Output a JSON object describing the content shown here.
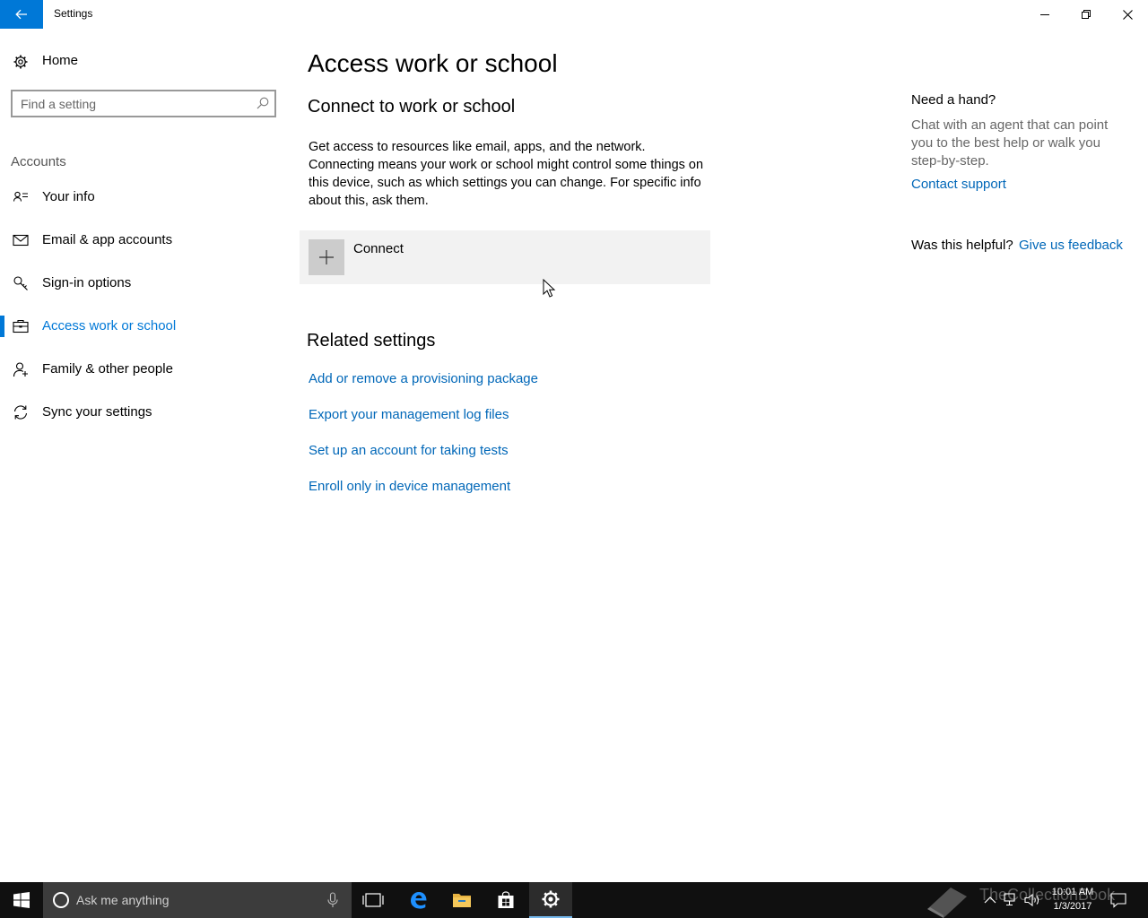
{
  "window": {
    "title": "Settings"
  },
  "sidebar": {
    "home_label": "Home",
    "search_placeholder": "Find a setting",
    "section_label": "Accounts",
    "items": [
      {
        "label": "Your info",
        "icon": "contact-card-icon",
        "active": false
      },
      {
        "label": "Email & app accounts",
        "icon": "mail-icon",
        "active": false
      },
      {
        "label": "Sign-in options",
        "icon": "key-icon",
        "active": false
      },
      {
        "label": "Access work or school",
        "icon": "briefcase-icon",
        "active": true
      },
      {
        "label": "Family & other people",
        "icon": "person-add-icon",
        "active": false
      },
      {
        "label": "Sync your settings",
        "icon": "sync-icon",
        "active": false
      }
    ]
  },
  "main": {
    "title": "Access work or school",
    "subtitle": "Connect to work or school",
    "description": "Get access to resources like email, apps, and the network. Connecting means your work or school might control some things on this device, such as which settings you can change. For specific info about this, ask them.",
    "connect_label": "Connect",
    "related_title": "Related settings",
    "related_links": [
      "Add or remove a provisioning package",
      "Export your management log files",
      "Set up an account for taking tests",
      "Enroll only in device management"
    ]
  },
  "help": {
    "title": "Need a hand?",
    "description": "Chat with an agent that can point you to the best help or walk you step-by-step.",
    "contact_link": "Contact support",
    "helpful_label": "Was this helpful?",
    "feedback_link": "Give us feedback"
  },
  "taskbar": {
    "search_placeholder": "Ask me anything",
    "watermark": "TheCollectionBook",
    "time": "10:01 AM",
    "date": "1/3/2017"
  },
  "colors": {
    "accent": "#0078d7",
    "link": "#0067b8",
    "taskbar": "#101010"
  }
}
